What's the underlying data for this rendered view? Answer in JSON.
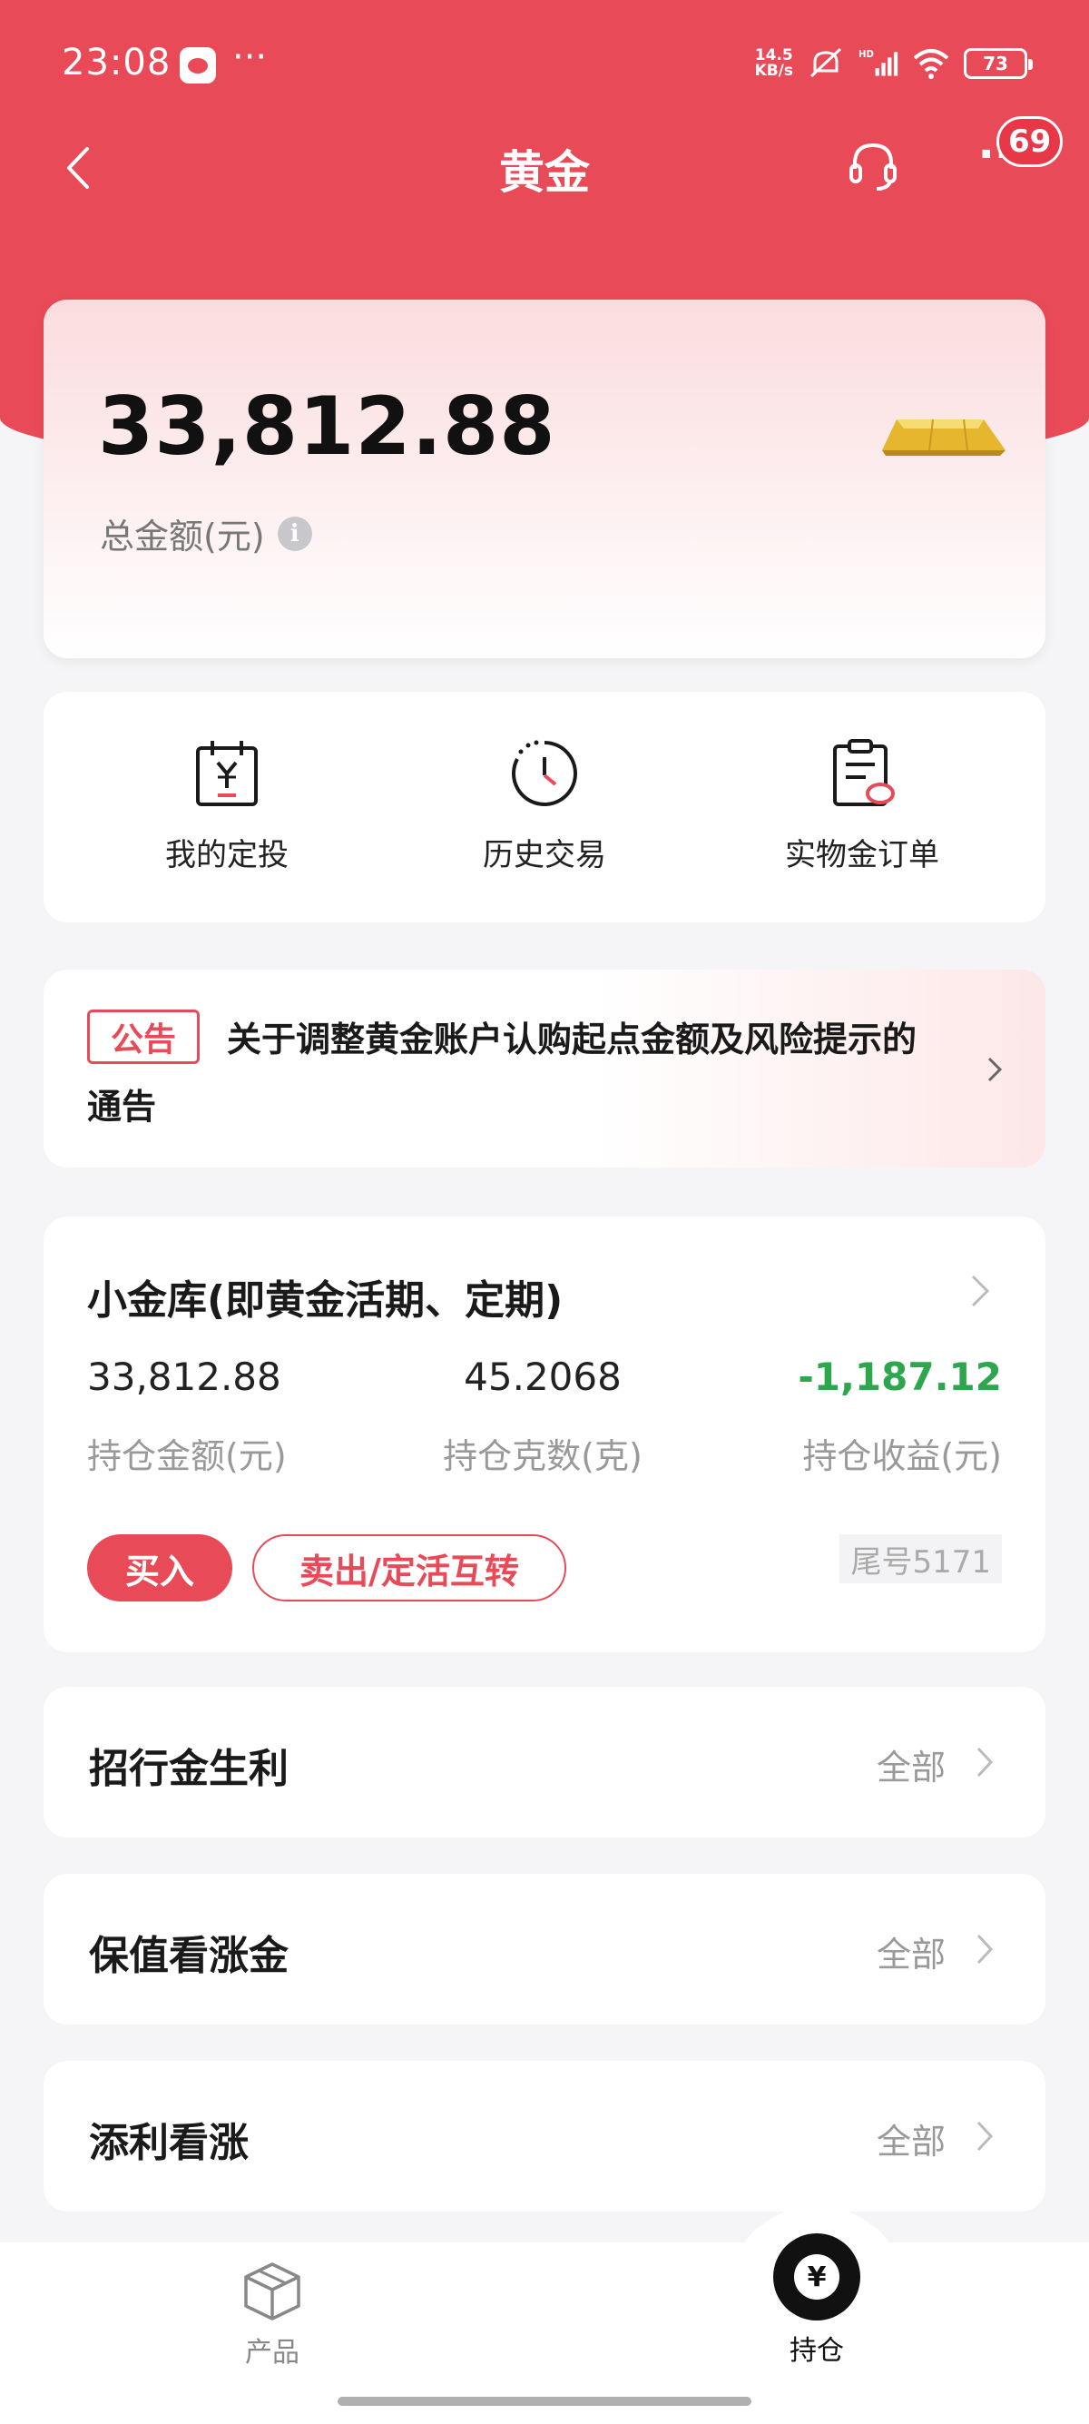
{
  "status_bar": {
    "time": "23:08",
    "dots": "···",
    "net_speed_value": "14.5",
    "net_speed_unit": "KB/s",
    "signal_label": "HD",
    "battery": "73"
  },
  "nav": {
    "title": "黄金",
    "more": "···",
    "badge": "69"
  },
  "balance": {
    "amount": "33,812.88",
    "label": "总金额(元)"
  },
  "shortcuts": [
    {
      "label": "我的定投",
      "icon": "calendar-yuan-icon"
    },
    {
      "label": "历史交易",
      "icon": "clock-history-icon"
    },
    {
      "label": "实物金订单",
      "icon": "clipboard-order-icon"
    }
  ],
  "notice": {
    "tag": "公告",
    "text": "关于调整黄金账户认购起点金额及风险提示的通告"
  },
  "vault": {
    "title": "小金库(即黄金活期、定期)",
    "stats": [
      {
        "value": "33,812.88",
        "label": "持仓金额(元)"
      },
      {
        "value": "45.2068",
        "label": "持仓克数(克)"
      },
      {
        "value": "-1,187.12",
        "label": "持仓收益(元)"
      }
    ],
    "buy_label": "买入",
    "sell_label": "卖出/定活互转",
    "tail_number": "尾号5171",
    "profit_color": "#2ea64e"
  },
  "products": [
    {
      "name": "招行金生利",
      "all": "全部"
    },
    {
      "name": "保值看涨金",
      "all": "全部"
    },
    {
      "name": "添利看涨",
      "all": "全部"
    }
  ],
  "tabbar": {
    "products_label": "产品",
    "holdings_label": "持仓",
    "holdings_icon_glyph": "¥"
  },
  "colors": {
    "brand": "#e94a58",
    "profit_negative": "#2ea64e"
  }
}
